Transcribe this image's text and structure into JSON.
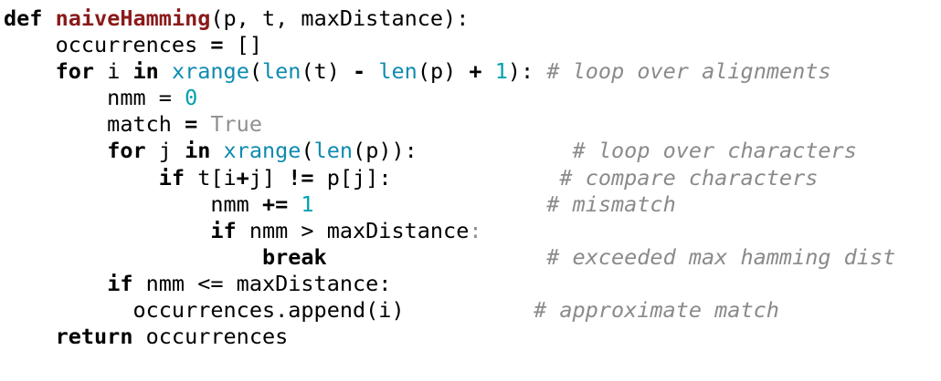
{
  "code": {
    "lines": [
      [
        {
          "t": "def",
          "c": "kw"
        },
        {
          "t": " "
        },
        {
          "t": "naiveHamming",
          "c": "fn"
        },
        {
          "t": "(p, t, maxDistance):"
        }
      ],
      [
        {
          "t": "    occurrences "
        },
        {
          "t": "=",
          "c": "op"
        },
        {
          "t": " []"
        }
      ],
      [
        {
          "t": "    "
        },
        {
          "t": "for",
          "c": "kw"
        },
        {
          "t": " i "
        },
        {
          "t": "in",
          "c": "kw"
        },
        {
          "t": " "
        },
        {
          "t": "xrange",
          "c": "bi"
        },
        {
          "t": "("
        },
        {
          "t": "len",
          "c": "bi"
        },
        {
          "t": "(t) "
        },
        {
          "t": "-",
          "c": "op"
        },
        {
          "t": " "
        },
        {
          "t": "len",
          "c": "bi"
        },
        {
          "t": "(p) "
        },
        {
          "t": "+",
          "c": "op"
        },
        {
          "t": " "
        },
        {
          "t": "1",
          "c": "num"
        },
        {
          "t": "): "
        },
        {
          "t": "# loop over alignments",
          "c": "cm"
        }
      ],
      [
        {
          "t": "        nmm "
        },
        {
          "t": "="
        },
        {
          "t": " "
        },
        {
          "t": "0",
          "c": "num"
        }
      ],
      [
        {
          "t": "        match "
        },
        {
          "t": "=",
          "c": "op"
        },
        {
          "t": " "
        },
        {
          "t": "True",
          "c": "const"
        }
      ],
      [
        {
          "t": "        "
        },
        {
          "t": "for",
          "c": "kw"
        },
        {
          "t": " j "
        },
        {
          "t": "in",
          "c": "kw"
        },
        {
          "t": " "
        },
        {
          "t": "xrange",
          "c": "bi"
        },
        {
          "t": "("
        },
        {
          "t": "len",
          "c": "bi"
        },
        {
          "t": "(p)):            "
        },
        {
          "t": "# loop over characters",
          "c": "cm"
        }
      ],
      [
        {
          "t": "            "
        },
        {
          "t": "if",
          "c": "kw"
        },
        {
          "t": " t[i"
        },
        {
          "t": "+",
          "c": "op"
        },
        {
          "t": "j] "
        },
        {
          "t": "!=",
          "c": "op"
        },
        {
          "t": " p[j]:             "
        },
        {
          "t": "# compare characters",
          "c": "cm"
        }
      ],
      [
        {
          "t": "                nmm "
        },
        {
          "t": "+=",
          "c": "op"
        },
        {
          "t": " "
        },
        {
          "t": "1",
          "c": "num"
        },
        {
          "t": "                  "
        },
        {
          "t": "# mismatch",
          "c": "cm"
        }
      ],
      [
        {
          "t": "                "
        },
        {
          "t": "if",
          "c": "kw"
        },
        {
          "t": " nmm > maxDistance"
        },
        {
          "t": ":",
          "c": "const"
        }
      ],
      [
        {
          "t": "                    "
        },
        {
          "t": "break",
          "c": "kw"
        },
        {
          "t": "                 "
        },
        {
          "t": "# exceeded max hamming dist",
          "c": "cm"
        }
      ],
      [
        {
          "t": "        "
        },
        {
          "t": "if",
          "c": "kw"
        },
        {
          "t": " nmm <= maxDistance:"
        }
      ],
      [
        {
          "t": "          occurrences.append(i)          "
        },
        {
          "t": "# approximate match",
          "c": "cm"
        }
      ],
      [
        {
          "t": "    "
        },
        {
          "t": "return",
          "c": "kw"
        },
        {
          "t": " occurrences"
        }
      ]
    ]
  }
}
